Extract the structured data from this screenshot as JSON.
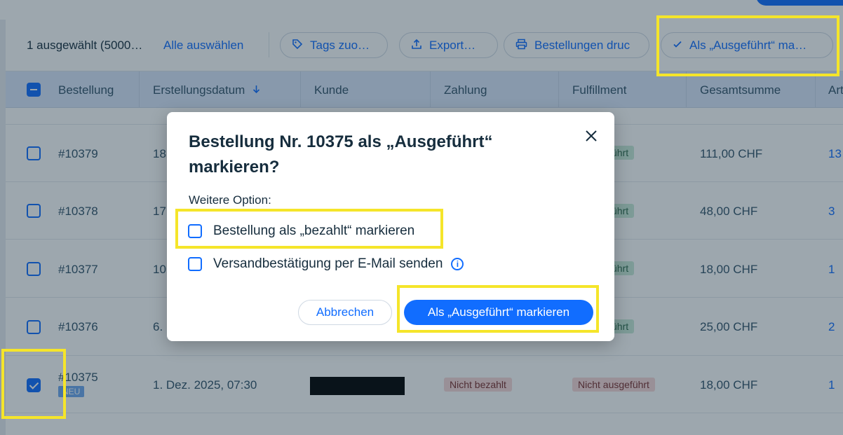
{
  "toolbar": {
    "selection_text": "1 ausgewählt (5000…",
    "select_all": "Alle auswählen",
    "actions": [
      {
        "label": "Tags zuo…",
        "icon": "tag-icon"
      },
      {
        "label": "Export…",
        "icon": "export-icon"
      },
      {
        "label": "Bestellungen druc",
        "icon": "printer-icon"
      },
      {
        "label": "Als „Ausgeführt“ ma…",
        "icon": "checkmark-icon"
      }
    ]
  },
  "table": {
    "columns": [
      "Bestellung",
      "Erstellungsdatum",
      "Kunde",
      "Zahlung",
      "Fulfillment",
      "Gesamtsumme",
      "Art"
    ],
    "sort_icon": "arrow-down-icon",
    "rows": [
      {
        "order": "#10379",
        "date": "18",
        "fulfillment": "ührt",
        "total": "111,00 CHF",
        "items": "13"
      },
      {
        "order": "#10378",
        "date": "17.",
        "fulfillment": "ührt",
        "total": "48,00 CHF",
        "items": "3"
      },
      {
        "order": "#10377",
        "date": "10",
        "fulfillment": "ührt",
        "total": "18,00 CHF",
        "items": "1"
      },
      {
        "order": "#10376",
        "date": "6.",
        "fulfillment": "ührt",
        "total": "25,00 CHF",
        "items": "2"
      },
      {
        "order": "#10375",
        "badge": "NEU",
        "date": "1. Dez. 2025, 07:30",
        "payment": "Nicht bezahlt",
        "fulfillment": "Nicht ausgeführt",
        "total": "18,00 CHF",
        "items": "1"
      }
    ]
  },
  "modal": {
    "title": "Bestellung Nr. 10375 als „Ausgeführt“ markieren?",
    "close_icon": "close-icon",
    "options_label": "Weitere Option:",
    "option_paid": "Bestellung als „bezahlt“ markieren",
    "option_email": "Versandbestätigung per E-Mail senden",
    "info_glyph": "i",
    "cancel": "Abbrechen",
    "confirm": "Als „Ausgeführt“ markieren"
  },
  "colors": {
    "accent": "#116dff",
    "highlight": "#f5e52a",
    "header_bg": "#dbe7fb",
    "badge_green_bg": "#c8ead7",
    "badge_red_bg": "#f8d7d7"
  }
}
